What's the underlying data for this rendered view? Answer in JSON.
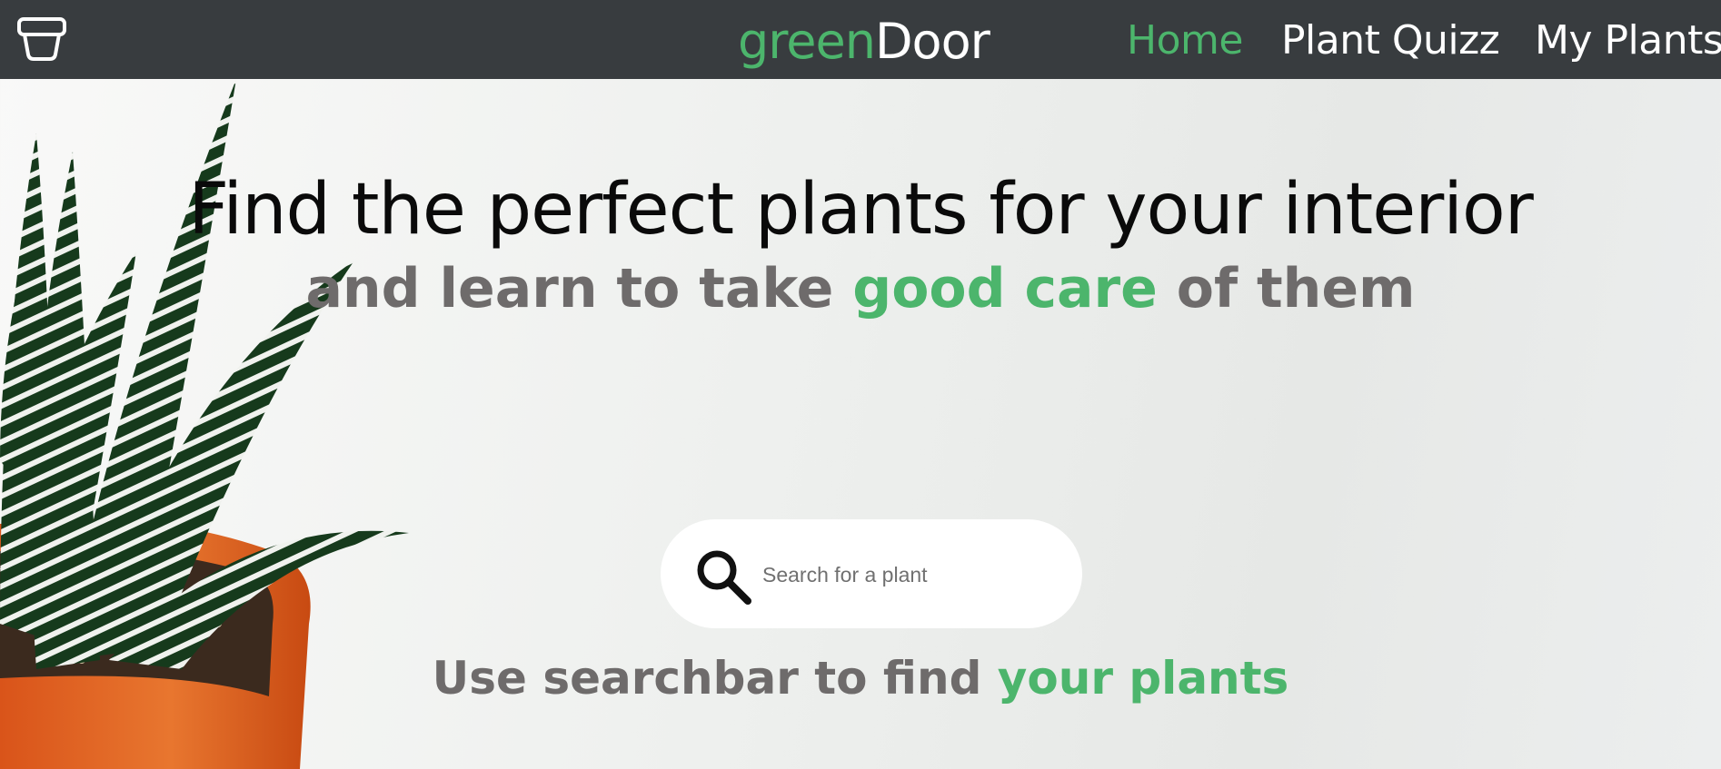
{
  "navbar": {
    "logo_icon": "plant-pot-icon",
    "brand_green": "green",
    "brand_white": "Door",
    "links": [
      {
        "label": "Home",
        "active": true
      },
      {
        "label": "Plant Quizz",
        "active": false
      },
      {
        "label": "My Plants",
        "active": false
      }
    ]
  },
  "hero": {
    "title": "Find the perfect plants for your interior",
    "subtitle_pre": "and learn to take ",
    "subtitle_highlight": "good care",
    "subtitle_post": " of them"
  },
  "search": {
    "icon": "search-icon",
    "placeholder": "Search for a plant",
    "value": ""
  },
  "hint": {
    "pre": "Use searchbar to find ",
    "highlight": "your plants"
  },
  "colors": {
    "accent": "#4cb56c",
    "navbar": "#383c3f",
    "subtitle_gray": "#6e6b6b"
  }
}
